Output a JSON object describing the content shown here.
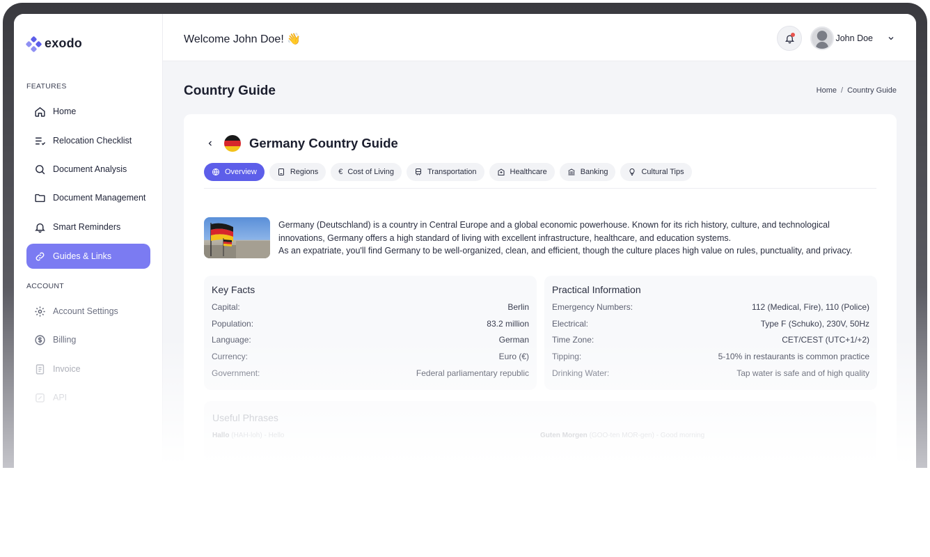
{
  "app": {
    "logo_text": "exodo"
  },
  "colors": {
    "accent": "#5d5ee9",
    "active_nav": "#7b7bf2",
    "notification": "#e8544e"
  },
  "sidebar": {
    "features_label": "FEATURES",
    "account_label": "ACCOUNT",
    "features": [
      {
        "label": "Home",
        "icon": "home-icon"
      },
      {
        "label": "Relocation Checklist",
        "icon": "checklist-icon"
      },
      {
        "label": "Document Analysis",
        "icon": "search-icon"
      },
      {
        "label": "Document Management",
        "icon": "folder-icon"
      },
      {
        "label": "Smart Reminders",
        "icon": "bell-icon"
      },
      {
        "label": "Guides & Links",
        "icon": "link-icon",
        "active": true
      }
    ],
    "account": [
      {
        "label": "Account Settings",
        "icon": "gear-icon"
      },
      {
        "label": "Billing",
        "icon": "dollar-icon"
      },
      {
        "label": "Invoice",
        "icon": "invoice-icon"
      },
      {
        "label": "API",
        "icon": "api-icon"
      }
    ]
  },
  "header": {
    "welcome": "Welcome John Doe! 👋",
    "user_name": "John Doe"
  },
  "page": {
    "title": "Country Guide",
    "breadcrumb": [
      "Home",
      "Country Guide"
    ],
    "breadcrumb_sep": "/"
  },
  "guide": {
    "title": "Germany Country Guide",
    "tabs": [
      {
        "label": "Overview",
        "icon": "globe-icon",
        "active": true
      },
      {
        "label": "Regions",
        "icon": "map-icon"
      },
      {
        "label": "Cost of Living",
        "icon": "euro-icon"
      },
      {
        "label": "Transportation",
        "icon": "train-icon"
      },
      {
        "label": "Healthcare",
        "icon": "hospital-icon"
      },
      {
        "label": "Banking",
        "icon": "bank-icon"
      },
      {
        "label": "Cultural Tips",
        "icon": "lightbulb-icon"
      }
    ],
    "intro_1": "Germany (Deutschland) is a country in Central Europe and a global economic powerhouse. Known for its rich history, culture, and technological innovations, Germany offers a high standard of living with excellent infrastructure, healthcare, and education systems.",
    "intro_2": "As an expatriate, you'll find Germany to be well-organized, clean, and efficient, though the culture places high value on rules, punctuality, and privacy.",
    "key_facts": {
      "title": "Key Facts",
      "rows": [
        {
          "k": "Capital:",
          "v": "Berlin"
        },
        {
          "k": "Population:",
          "v": "83.2 million"
        },
        {
          "k": "Language:",
          "v": "German"
        },
        {
          "k": "Currency:",
          "v": "Euro (€)"
        },
        {
          "k": "Government:",
          "v": "Federal parliamentary republic"
        }
      ]
    },
    "practical": {
      "title": "Practical Information",
      "rows": [
        {
          "k": "Emergency Numbers:",
          "v": "112 (Medical, Fire), 110 (Police)"
        },
        {
          "k": "Electrical:",
          "v": "Type F (Schuko), 230V, 50Hz"
        },
        {
          "k": "Time Zone:",
          "v": "CET/CEST (UTC+1/+2)"
        },
        {
          "k": "Tipping:",
          "v": "5-10% in restaurants is common practice"
        },
        {
          "k": "Drinking Water:",
          "v": "Tap water is safe and of high quality"
        }
      ]
    },
    "phrases": {
      "title": "Useful Phrases",
      "items": [
        {
          "word": "Hallo",
          "rest": "(HAH-loh) - Hello"
        },
        {
          "word": "Guten Morgen",
          "rest": "(GOO-ten MOR-gen) - Good morning"
        }
      ]
    }
  }
}
